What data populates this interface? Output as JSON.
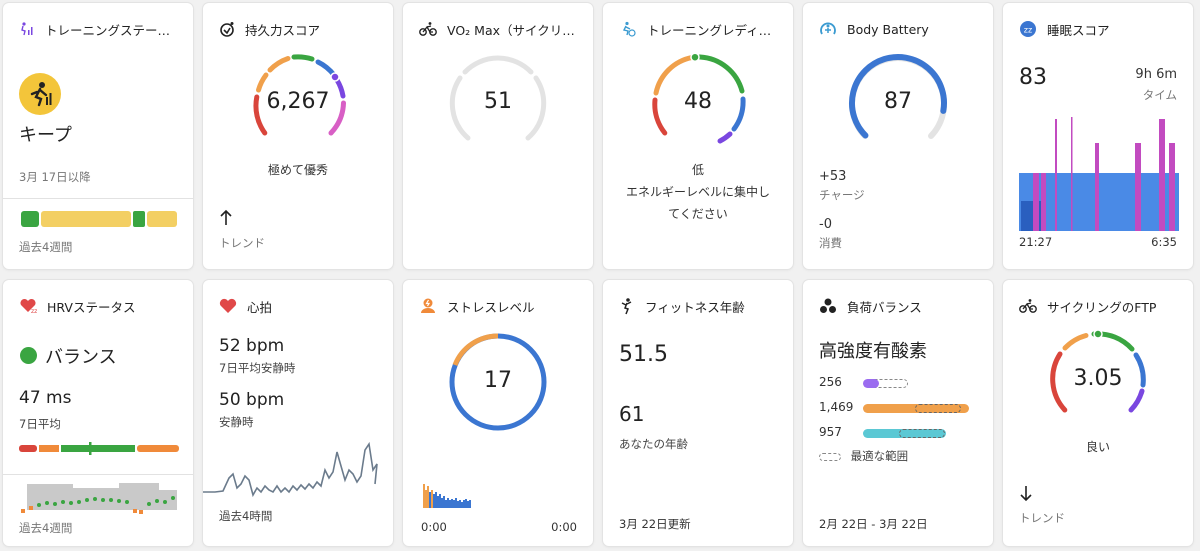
{
  "cards": {
    "training_status": {
      "title": "トレーニングステー…",
      "status": "キープ",
      "since": "3月 17日以降",
      "period": "過去4週間",
      "color": "#f3c53a"
    },
    "endurance": {
      "title": "持久力スコア",
      "score": "6,267",
      "label": "極めて優秀",
      "trend_label": "トレンド"
    },
    "vo2max": {
      "title": "VO₂ Max（サイクリ…",
      "value": "51"
    },
    "readiness": {
      "title": "トレーニングレディ…",
      "value": "48",
      "level": "低",
      "message_line1": "エネルギーレベルに集中し",
      "message_line2": "てください"
    },
    "body_battery": {
      "title": "Body Battery",
      "value": "87",
      "charge_value": "+53",
      "charge_label": "チャージ",
      "drain_value": "-0",
      "drain_label": "消費",
      "level_fraction": 0.87
    },
    "sleep": {
      "title": "睡眠スコア",
      "score": "83",
      "duration": "9h 6m",
      "duration_label": "タイム",
      "start": "21:27",
      "end": "6:35"
    },
    "hrv": {
      "title": "HRVステータス",
      "status": "バランス",
      "value": "47 ms",
      "value_label": "7日平均",
      "period": "過去4週間",
      "status_color": "#3aa541"
    },
    "heart_rate": {
      "title": "心拍",
      "avg_value": "52 bpm",
      "avg_label": "7日平均安静時",
      "rest_value": "50 bpm",
      "rest_label": "安静時",
      "period": "過去4時間"
    },
    "stress": {
      "title": "ストレスレベル",
      "value": "17",
      "start": "0:00",
      "end": "0:00"
    },
    "fitness_age": {
      "title": "フィットネス年齢",
      "fitness_age": "51.5",
      "actual_age": "61",
      "actual_label": "あなたの年齢",
      "updated": "3月 22日更新"
    },
    "load_balance": {
      "title": "負荷バランス",
      "focus": "高強度有酸素",
      "rows": [
        {
          "value": "256",
          "color": "#9b6cf0",
          "fraction": 0.13
        },
        {
          "value": "1,469",
          "color": "#f0a04b",
          "fraction": 1.0
        },
        {
          "value": "957",
          "color": "#5bc8d4",
          "fraction": 0.78
        }
      ],
      "legend": "最適な範囲",
      "date_range": "2月 22日 - 3月 22日"
    },
    "ftp": {
      "title": "サイクリングのFTP",
      "value": "3.05",
      "label": "良い",
      "trend_label": "トレンド"
    }
  },
  "colors": {
    "red": "#d9453b",
    "orange": "#f0a04b",
    "green": "#3aa541",
    "blue": "#3b76d1",
    "purple": "#7a47e0",
    "pink": "#d85fc5",
    "gray": "#e3e3e3",
    "sleep_blue": "#4a8ae6",
    "sleep_pink": "#c24bc0"
  }
}
